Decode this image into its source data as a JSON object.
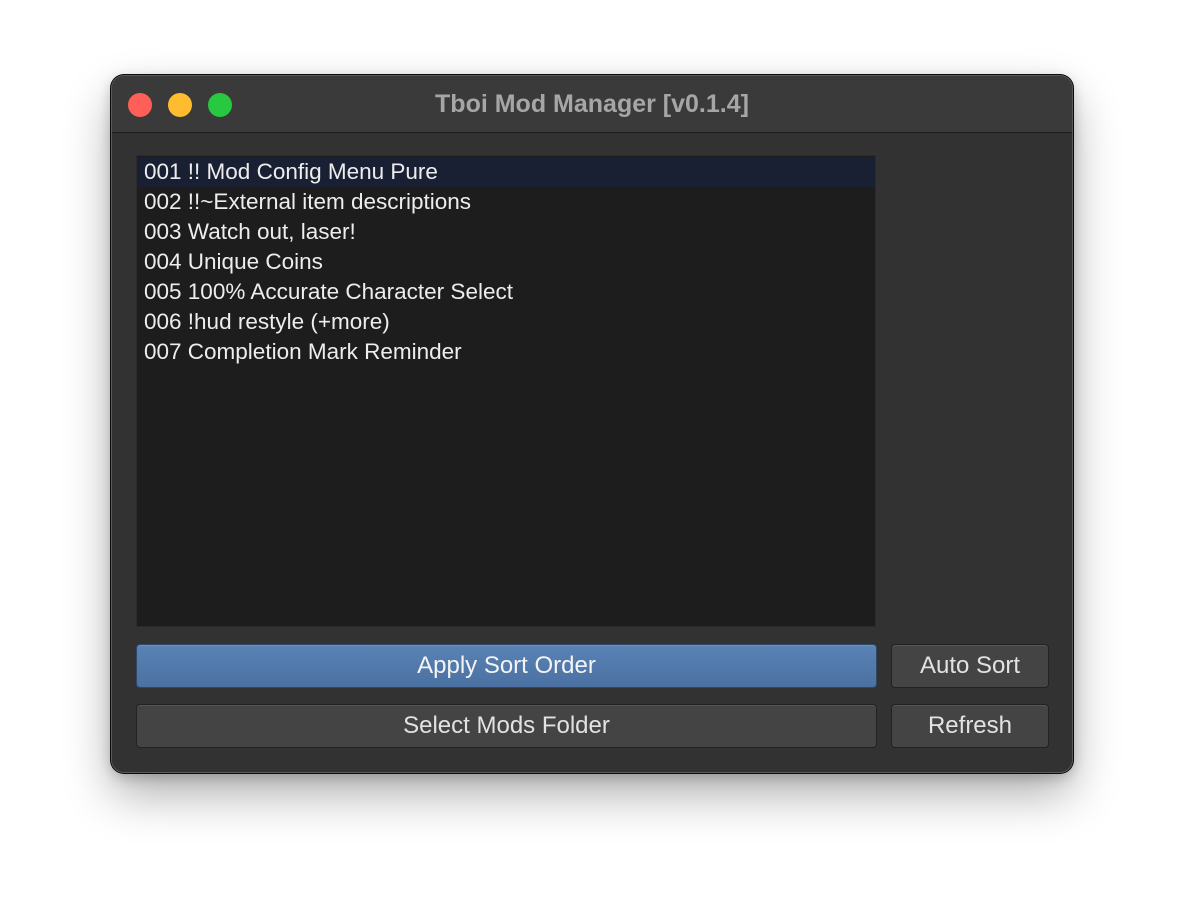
{
  "window": {
    "title": "Tboi Mod Manager [v0.1.4]"
  },
  "traffic_lights": {
    "close": "close-button",
    "minimize": "minimize-button",
    "zoom": "zoom-button",
    "colors": {
      "close": "#ff5f57",
      "minimize": "#febc2e",
      "zoom": "#28c840"
    }
  },
  "mod_list": {
    "selected_index": 0,
    "items": [
      {
        "label": "001 !! Mod Config Menu Pure"
      },
      {
        "label": "002 !!~External item descriptions"
      },
      {
        "label": "003 Watch out, laser!"
      },
      {
        "label": "004 Unique Coins"
      },
      {
        "label": "005 100% Accurate Character Select"
      },
      {
        "label": "006 !hud restyle (+more)"
      },
      {
        "label": "007 Completion Mark Reminder"
      }
    ]
  },
  "buttons": {
    "apply_sort_order": "Apply Sort Order",
    "auto_sort": "Auto Sort",
    "select_mods_folder": "Select Mods Folder",
    "refresh": "Refresh"
  },
  "colors": {
    "primary_button": "#4f77a8",
    "window_background": "#323232",
    "list_background": "#1d1d1d"
  }
}
